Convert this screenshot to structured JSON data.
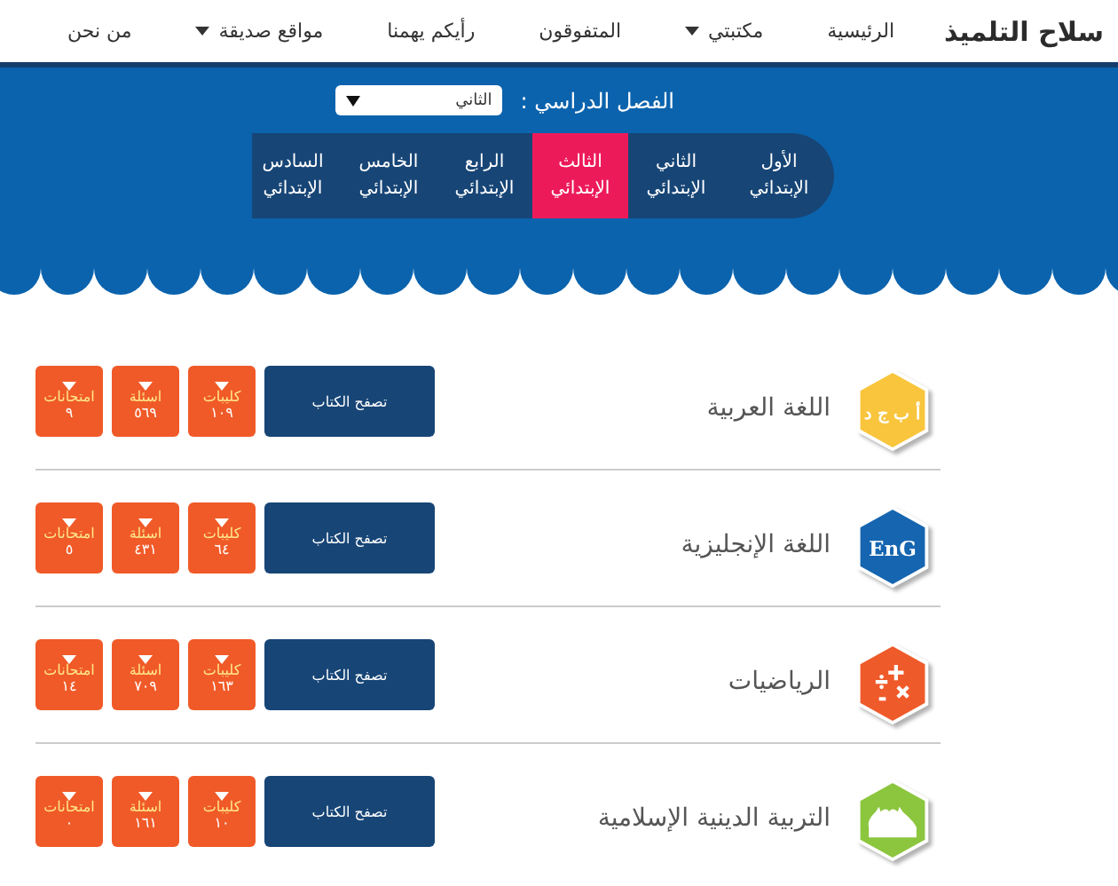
{
  "logo": "سلاح التلميذ",
  "nav": [
    {
      "label": "الرئيسية",
      "dropdown": false
    },
    {
      "label": "مكتبتي",
      "dropdown": true
    },
    {
      "label": "المتفوقون",
      "dropdown": false
    },
    {
      "label": "رأيكم يهمنا",
      "dropdown": false
    },
    {
      "label": "مواقع صديقة",
      "dropdown": true
    },
    {
      "label": "من نحن",
      "dropdown": false
    }
  ],
  "semester": {
    "label": "الفصل الدراسي :",
    "value": "الثاني"
  },
  "grades": [
    {
      "line1": "الأول",
      "line2": "الإبتدائي",
      "selected": false
    },
    {
      "line1": "الثاني",
      "line2": "الإبتدائي",
      "selected": false
    },
    {
      "line1": "الثالث",
      "line2": "الإبتدائي",
      "selected": true
    },
    {
      "line1": "الرابع",
      "line2": "الإبتدائي",
      "selected": false
    },
    {
      "line1": "الخامس",
      "line2": "الإبتدائي",
      "selected": false
    },
    {
      "line1": "السادس",
      "line2": "الإبتدائي",
      "selected": false
    }
  ],
  "subjects": [
    {
      "title": "اللغة العربية",
      "kind": "arabic",
      "color": "#f9c53d",
      "icon_text": "أ ب ج د",
      "browse": "تصفح الكتاب",
      "stats": [
        {
          "label": "كليبات",
          "value": "١٠٩"
        },
        {
          "label": "اسئلة",
          "value": "٥٦٩"
        },
        {
          "label": "امتحانات",
          "value": "٩"
        }
      ]
    },
    {
      "title": "اللغة الإنجليزية",
      "kind": "english",
      "color": "#1565b0",
      "icon_text": "EnG",
      "browse": "تصفح الكتاب",
      "stats": [
        {
          "label": "كليبات",
          "value": "٦٤"
        },
        {
          "label": "اسئلة",
          "value": "٤٣١"
        },
        {
          "label": "امتحانات",
          "value": "٥"
        }
      ]
    },
    {
      "title": "الرياضيات",
      "kind": "math",
      "color": "#ef5a2a",
      "browse": "تصفح الكتاب",
      "stats": [
        {
          "label": "كليبات",
          "value": "١٦٣"
        },
        {
          "label": "اسئلة",
          "value": "٧٠٩"
        },
        {
          "label": "امتحانات",
          "value": "١٤"
        }
      ]
    },
    {
      "title": "التربية الدينية الإسلامية",
      "kind": "islamic",
      "color": "#8cc63f",
      "browse": "تصفح الكتاب",
      "stats": [
        {
          "label": "كليبات",
          "value": "١٠"
        },
        {
          "label": "اسئلة",
          "value": "١٦١"
        },
        {
          "label": "امتحانات",
          "value": "٠"
        }
      ]
    }
  ]
}
